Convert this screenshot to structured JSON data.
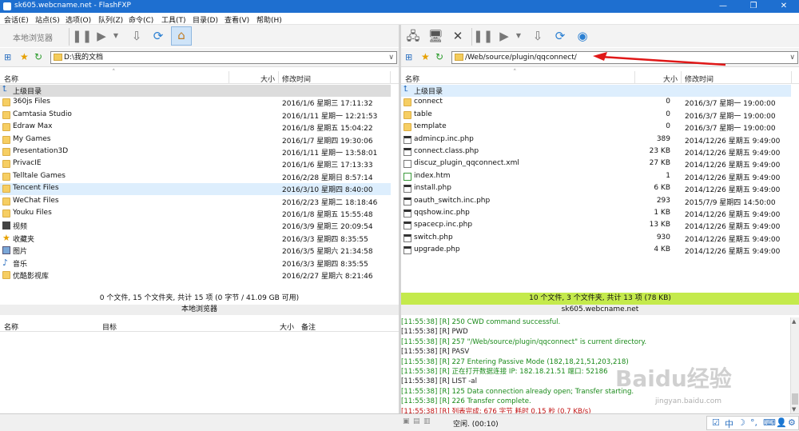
{
  "window": {
    "title": "sk605.webcname.net - FlashFXP"
  },
  "menu": [
    "会话(E)",
    "站点(S)",
    "选项(O)",
    "队列(Z)",
    "命令(C)",
    "工具(T)",
    "目录(D)",
    "查看(V)",
    "帮助(H)"
  ],
  "left": {
    "toolbar_label": "本地浏览器",
    "path": "D:\\我的文档",
    "columns": {
      "name": "名称",
      "size": "大小",
      "modified": "修改时间"
    },
    "rows": [
      {
        "name": "上级目录",
        "size": "",
        "date": "",
        "type": "up"
      },
      {
        "name": "360js Files",
        "size": "",
        "date": "2016/1/6 星期三 17:11:32",
        "type": "folder"
      },
      {
        "name": "Camtasia Studio",
        "size": "",
        "date": "2016/1/11 星期一 12:21:53",
        "type": "folder"
      },
      {
        "name": "Edraw Max",
        "size": "",
        "date": "2016/1/8 星期五 15:04:22",
        "type": "folder"
      },
      {
        "name": "My Games",
        "size": "",
        "date": "2016/1/7 星期四 19:30:06",
        "type": "folder"
      },
      {
        "name": "Presentation3D",
        "size": "",
        "date": "2016/1/11 星期一 13:58:01",
        "type": "folder"
      },
      {
        "name": "PrivacIE",
        "size": "",
        "date": "2016/1/6 星期三 17:13:33",
        "type": "folder"
      },
      {
        "name": "Telltale Games",
        "size": "",
        "date": "2016/2/28 星期日 8:57:14",
        "type": "folder"
      },
      {
        "name": "Tencent Files",
        "size": "",
        "date": "2016/3/10 星期四 8:40:00",
        "type": "folder",
        "selected": true
      },
      {
        "name": "WeChat Files",
        "size": "",
        "date": "2016/2/23 星期二 18:18:46",
        "type": "folder"
      },
      {
        "name": "Youku Files",
        "size": "",
        "date": "2016/1/8 星期五 15:55:48",
        "type": "folder"
      },
      {
        "name": "视频",
        "size": "",
        "date": "2016/3/9 星期三 20:09:54",
        "type": "video"
      },
      {
        "name": "收藏夹",
        "size": "",
        "date": "2016/3/3 星期四 8:35:55",
        "type": "star"
      },
      {
        "name": "图片",
        "size": "",
        "date": "2016/3/5 星期六 21:34:58",
        "type": "image"
      },
      {
        "name": "音乐",
        "size": "",
        "date": "2016/3/3 星期四 8:35:55",
        "type": "music"
      },
      {
        "name": "优酷影视库",
        "size": "",
        "date": "2016/2/27 星期六 8:21:46",
        "type": "folder"
      }
    ],
    "status": "0 个文件, 15 个文件夹, 共计 15 项 (0 字节 / 41.09 GB 可用)",
    "status2": "本地浏览器"
  },
  "right": {
    "path": "/Web/source/plugin/qqconnect/",
    "columns": {
      "name": "名称",
      "size": "大小",
      "modified": "修改时间"
    },
    "rows": [
      {
        "name": "上级目录",
        "size": "",
        "date": "",
        "type": "up",
        "selected": true
      },
      {
        "name": "connect",
        "size": "0",
        "date": "2016/3/7 星期一 19:00:00",
        "type": "folder"
      },
      {
        "name": "table",
        "size": "0",
        "date": "2016/3/7 星期一 19:00:00",
        "type": "folder"
      },
      {
        "name": "template",
        "size": "0",
        "date": "2016/3/7 星期一 19:00:00",
        "type": "folder"
      },
      {
        "name": "admincp.inc.php",
        "size": "389",
        "date": "2014/12/26 星期五 9:49:00",
        "type": "php"
      },
      {
        "name": "connect.class.php",
        "size": "23 KB",
        "date": "2014/12/26 星期五 9:49:00",
        "type": "php"
      },
      {
        "name": "discuz_plugin_qqconnect.xml",
        "size": "27 KB",
        "date": "2014/12/26 星期五 9:49:00",
        "type": "file"
      },
      {
        "name": "index.htm",
        "size": "1",
        "date": "2014/12/26 星期五 9:49:00",
        "type": "htm"
      },
      {
        "name": "install.php",
        "size": "6 KB",
        "date": "2014/12/26 星期五 9:49:00",
        "type": "php"
      },
      {
        "name": "oauth_switch.inc.php",
        "size": "293",
        "date": "2015/7/9 星期四 14:50:00",
        "type": "php"
      },
      {
        "name": "qqshow.inc.php",
        "size": "1 KB",
        "date": "2014/12/26 星期五 9:49:00",
        "type": "php"
      },
      {
        "name": "spacecp.inc.php",
        "size": "13 KB",
        "date": "2014/12/26 星期五 9:49:00",
        "type": "php"
      },
      {
        "name": "switch.php",
        "size": "930",
        "date": "2014/12/26 星期五 9:49:00",
        "type": "php"
      },
      {
        "name": "upgrade.php",
        "size": "4 KB",
        "date": "2014/12/26 星期五 9:49:00",
        "type": "php"
      }
    ],
    "status": "10 个文件, 3 个文件夹, 共计 13 项 (78 KB)",
    "status2": "sk605.webcname.net",
    "status_color": "#c4ea4c"
  },
  "queue": {
    "columns": {
      "name": "名称",
      "target": "目标",
      "size": "大小",
      "note": "备注"
    }
  },
  "log": [
    {
      "text": "[11:55:38] [R] 250 CWD command successful.",
      "c": "lg"
    },
    {
      "text": "[11:55:38] [R] PWD",
      "c": "lb"
    },
    {
      "text": "[11:55:38] [R] 257 \"/Web/source/plugin/qqconnect\" is current directory.",
      "c": "lg"
    },
    {
      "text": "[11:55:38] [R] PASV",
      "c": "lb"
    },
    {
      "text": "[11:55:38] [R] 227 Entering Passive Mode (182,18,21,51,203,218)",
      "c": "lg"
    },
    {
      "text": "[11:55:38] [R] 正在打开数据连接 IP: 182.18.21.51 端口: 52186",
      "c": "lg"
    },
    {
      "text": "[11:55:38] [R] LIST -al",
      "c": "lb"
    },
    {
      "text": "[11:55:38] [R] 125 Data connection already open; Transfer starting.",
      "c": "lg"
    },
    {
      "text": "[11:55:38] [R] 226 Transfer complete.",
      "c": "lg"
    },
    {
      "text": "[11:55:38] [R] 列表完成: 676 字节 耗时 0.15 秒 (0.7 KB/s)",
      "c": "lr"
    }
  ],
  "bottom": {
    "idle": "空闲. (00:10)"
  },
  "watermark": {
    "brand": "Baidu经验",
    "url": "jingyan.baidu.com"
  }
}
